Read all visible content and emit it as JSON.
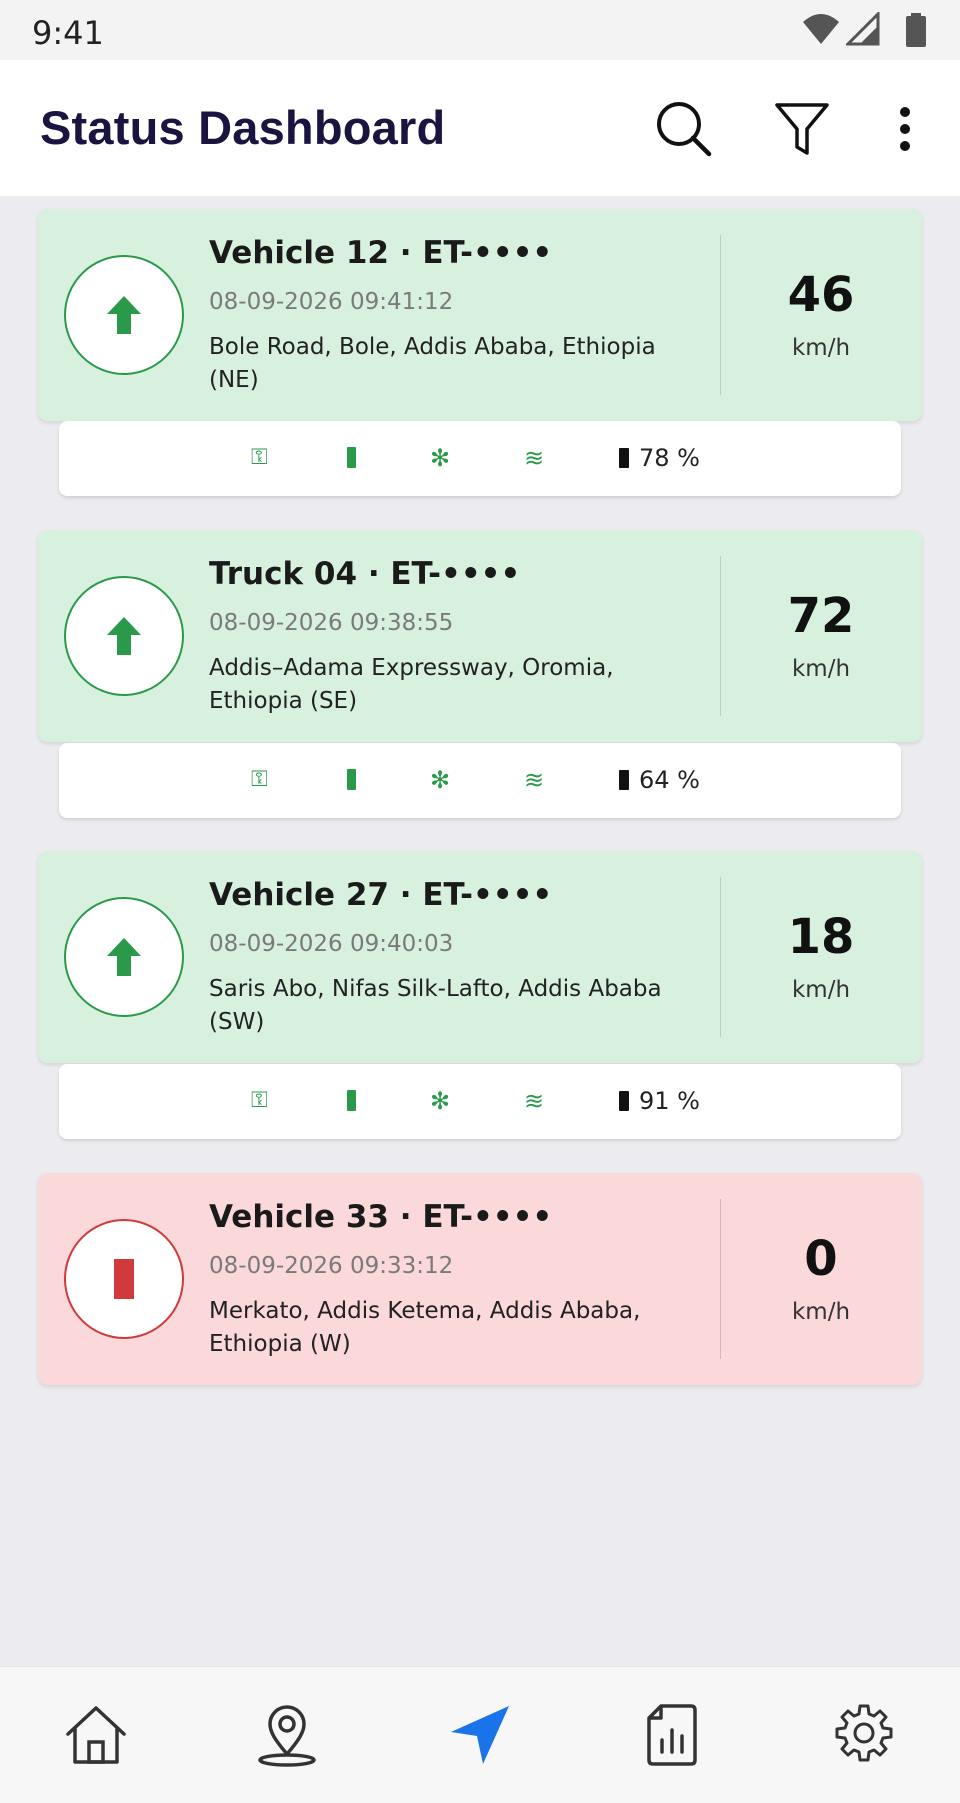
{
  "status_bar": {
    "time": "9:41"
  },
  "app_bar": {
    "title": "Status Dashboard"
  },
  "vehicles": [
    {
      "name": "Vehicle 12 · ET-••••",
      "timestamp": "08-09-2026 09:41:12",
      "address": "Bole Road, Bole, Addis Ababa, Ethiopia (NE)",
      "speed": "46",
      "unit": "km/h",
      "state": "moving",
      "battery": "78 %"
    },
    {
      "name": "Truck 04 · ET-••••",
      "timestamp": "08-09-2026 09:38:55",
      "address": "Addis–Adama Expressway, Oromia, Ethiopia (SE)",
      "speed": "72",
      "unit": "km/h",
      "state": "moving",
      "battery": "64 %"
    },
    {
      "name": "Vehicle 27 · ET-••••",
      "timestamp": "08-09-2026 09:40:03",
      "address": "Saris Abo, Nifas Silk-Lafto, Addis Ababa (SW)",
      "speed": "18",
      "unit": "km/h",
      "state": "moving",
      "battery": "91 %"
    },
    {
      "name": "Vehicle 33 · ET-••••",
      "timestamp": "08-09-2026 09:33:12",
      "address": "Merkato, Addis Ketema, Addis Ababa, Ethiopia (W)",
      "speed": "0",
      "unit": "km/h",
      "state": "stopped"
    }
  ],
  "sensor_icons": {
    "key": "⚿",
    "snow": "✻",
    "wave": "≋"
  },
  "colors": {
    "moving_bg": "#d8f1de",
    "stopped_bg": "#fbd8da",
    "moving_accent": "#2a9a4a",
    "stopped_accent": "#d03a3a",
    "active_nav": "#1a73e8"
  }
}
